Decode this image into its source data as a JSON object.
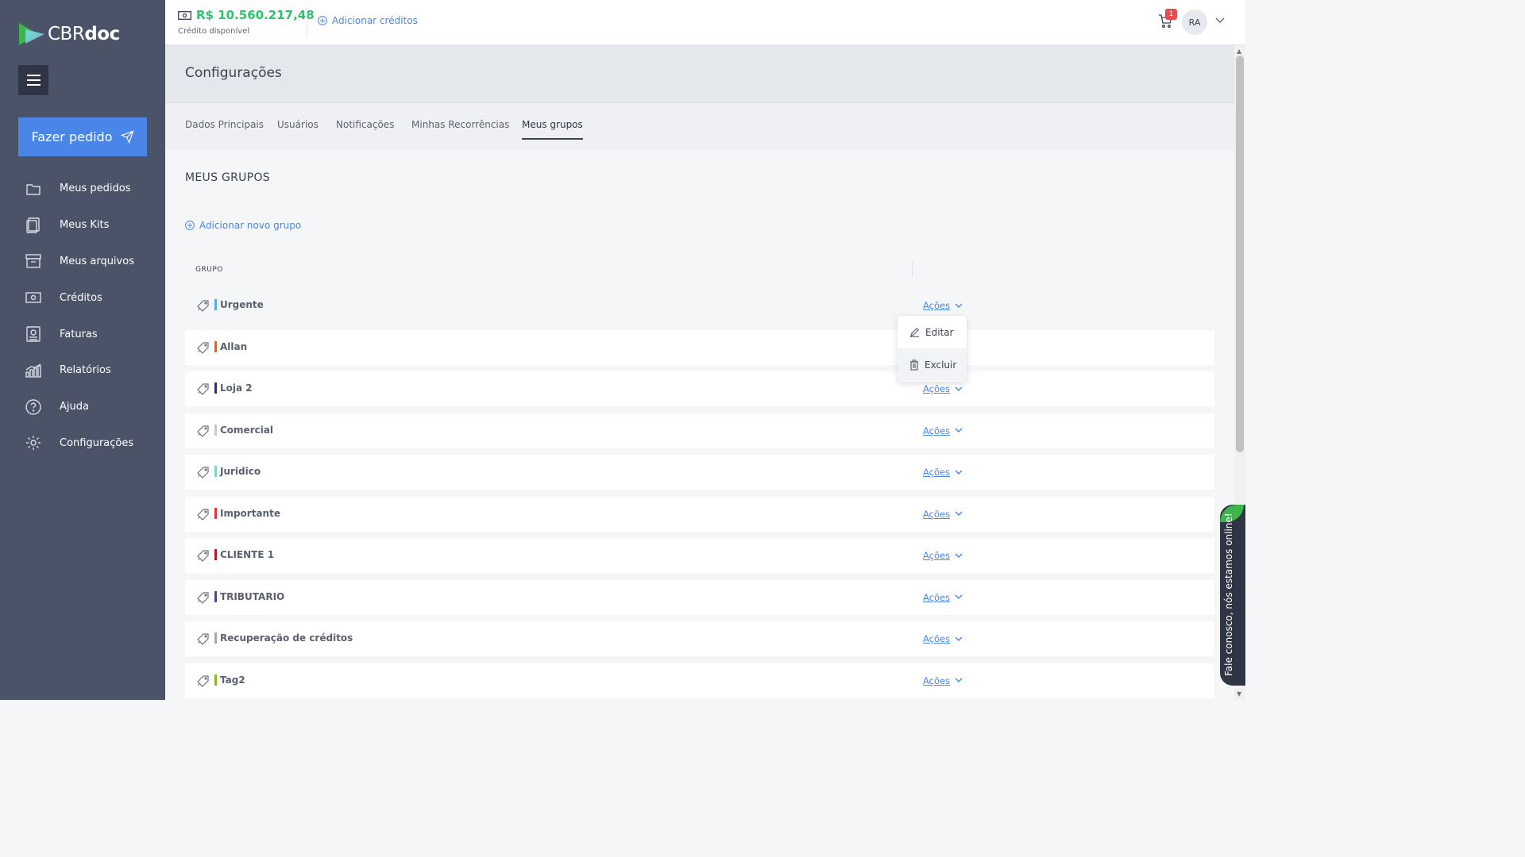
{
  "brand": {
    "name_light": "CBR",
    "name_bold": "doc",
    "leaf_color": "#3cb54a"
  },
  "sidebar": {
    "order_button": "Fazer pedido",
    "items": [
      {
        "label": "Meus pedidos",
        "icon": "folder-icon"
      },
      {
        "label": "Meus Kits",
        "icon": "kit-icon"
      },
      {
        "label": "Meus arquivos",
        "icon": "archive-icon"
      },
      {
        "label": "Créditos",
        "icon": "money-icon"
      },
      {
        "label": "Faturas",
        "icon": "invoice-icon"
      },
      {
        "label": "Relatórios",
        "icon": "chart-icon"
      },
      {
        "label": "Ajuda",
        "icon": "help-icon"
      },
      {
        "label": "Configurações",
        "icon": "gear-icon"
      }
    ]
  },
  "header": {
    "credit_amount": "R$ 10.560.217,48",
    "credit_label": "Crédito disponível",
    "add_credits": "Adicionar créditos",
    "cart_count": "1",
    "avatar_initials": "RA"
  },
  "page": {
    "title": "Configurações",
    "tabs": [
      "Dados Principais",
      "Usuários",
      "Notificações",
      "Minhas Recorrências",
      "Meus grupos"
    ],
    "active_tab": "Meus grupos"
  },
  "groups": {
    "section_title": "MEUS GRUPOS",
    "add_group": "Adicionar novo grupo",
    "column_header": "GRUPO",
    "actions_label": "Ações",
    "rows": [
      {
        "name": "Urgente",
        "color": "#5aa9e6"
      },
      {
        "name": "Allan",
        "color": "#c8703a"
      },
      {
        "name": "Loja 2",
        "color": "#3a2e6b"
      },
      {
        "name": "Comercial",
        "color": "#c8c8cc"
      },
      {
        "name": "Juridico",
        "color": "#7fd3c8"
      },
      {
        "name": "Importante",
        "color": "#e23838"
      },
      {
        "name": "CLIENTE 1",
        "color": "#b01e2a"
      },
      {
        "name": "TRIBUTARIO",
        "color": "#4a4f8c"
      },
      {
        "name": "Recuperação de créditos",
        "color": "#a8a8a8"
      },
      {
        "name": "Tag2",
        "color": "#8ab82a"
      }
    ],
    "dropdown": {
      "edit": "Editar",
      "delete": "Excluir"
    }
  },
  "chat": {
    "label": "Fale conosco, nós estamos online!"
  }
}
